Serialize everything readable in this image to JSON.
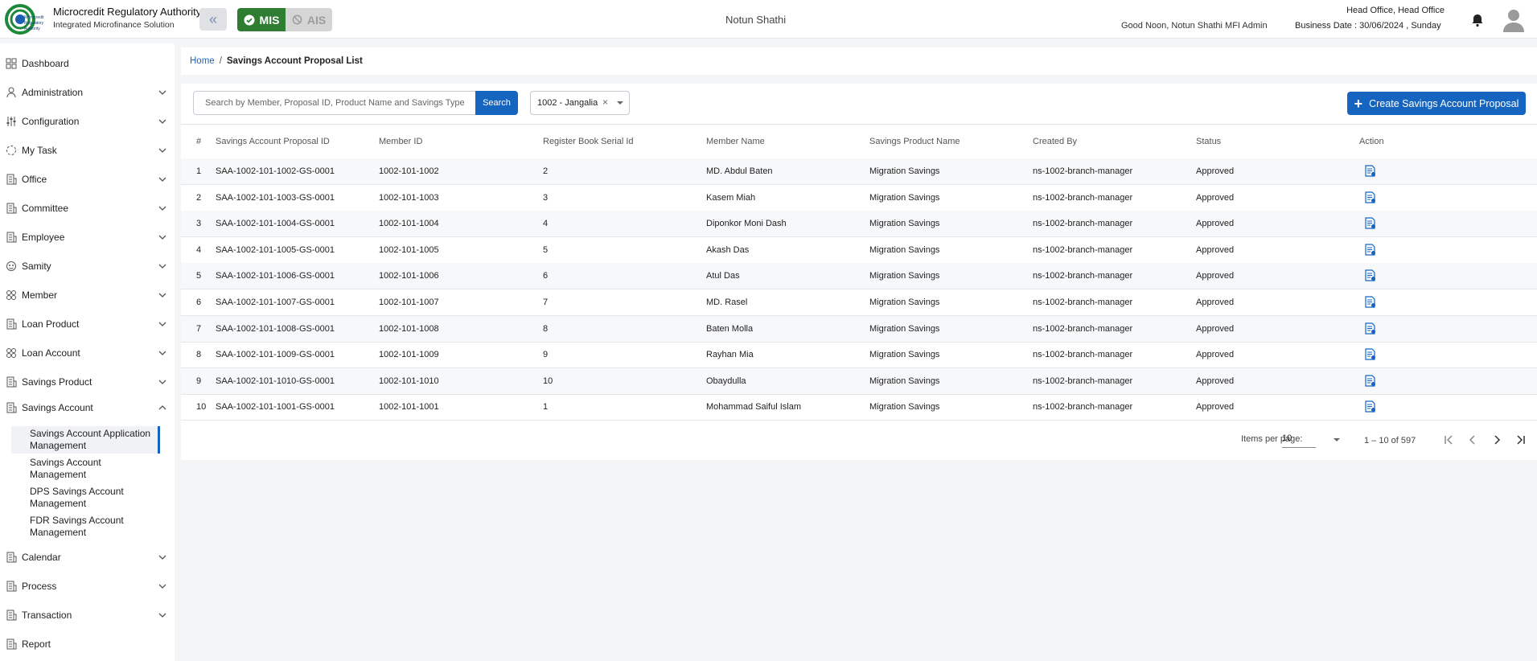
{
  "header": {
    "org_title": "Microcredit Regulatory Authority",
    "org_subtitle": "Integrated Microfinance Solution",
    "logo_text": "Microcredit Regulatory Authority",
    "mis_label": "MIS",
    "ais_label": "AIS",
    "center_title": "Notun Shathi",
    "greeting": "Good Noon, Notun Shathi MFI Admin",
    "office": "Head Office, Head Office",
    "business_date": "Business Date : 30/06/2024 , Sunday"
  },
  "sidebar": {
    "items": [
      {
        "label": "Dashboard",
        "icon": "dashboard-icon"
      },
      {
        "label": "Administration",
        "icon": "admin-icon"
      },
      {
        "label": "Configuration",
        "icon": "configuration-icon"
      },
      {
        "label": "My Task",
        "icon": "task-icon"
      },
      {
        "label": "Office",
        "icon": "office-icon"
      },
      {
        "label": "Committee",
        "icon": "committee-icon"
      },
      {
        "label": "Employee",
        "icon": "employee-icon"
      },
      {
        "label": "Samity",
        "icon": "samity-icon"
      },
      {
        "label": "Member",
        "icon": "member-icon"
      },
      {
        "label": "Loan Product",
        "icon": "loan-product-icon"
      },
      {
        "label": "Loan Account",
        "icon": "loan-account-icon"
      },
      {
        "label": "Savings Product",
        "icon": "savings-product-icon"
      },
      {
        "label": "Savings Account",
        "icon": "savings-account-icon"
      },
      {
        "label": "Calendar",
        "icon": "calendar-icon"
      },
      {
        "label": "Process",
        "icon": "process-icon"
      },
      {
        "label": "Transaction",
        "icon": "transaction-icon"
      },
      {
        "label": "Report",
        "icon": "report-icon"
      }
    ],
    "savings_sub": [
      "Savings Account Application Management",
      "Savings Account Management",
      "DPS Savings Account Management",
      "FDR Savings Account Management"
    ]
  },
  "breadcrumb": {
    "home": "Home",
    "separator": "/",
    "current": "Savings Account Proposal List"
  },
  "toolbar": {
    "search_placeholder": "Search by Member, Proposal ID, Product Name and Savings Type",
    "search_label": "Search",
    "branch_value": "1002 - Jangalia",
    "clear_symbol": "×",
    "create_label": "Create Savings Account Proposal"
  },
  "table": {
    "headers": [
      "#",
      "Savings Account Proposal ID",
      "Member ID",
      "Register Book Serial Id",
      "Member Name",
      "Savings Product Name",
      "Created By",
      "Status",
      "Action"
    ],
    "rows": [
      [
        "1",
        "SAA-1002-101-1002-GS-0001",
        "1002-101-1002",
        "2",
        "MD. Abdul Baten",
        "Migration Savings",
        "ns-1002-branch-manager",
        "Approved"
      ],
      [
        "2",
        "SAA-1002-101-1003-GS-0001",
        "1002-101-1003",
        "3",
        "Kasem Miah",
        "Migration Savings",
        "ns-1002-branch-manager",
        "Approved"
      ],
      [
        "3",
        "SAA-1002-101-1004-GS-0001",
        "1002-101-1004",
        "4",
        "Diponkor Moni Dash",
        "Migration Savings",
        "ns-1002-branch-manager",
        "Approved"
      ],
      [
        "4",
        "SAA-1002-101-1005-GS-0001",
        "1002-101-1005",
        "5",
        "Akash Das",
        "Migration Savings",
        "ns-1002-branch-manager",
        "Approved"
      ],
      [
        "5",
        "SAA-1002-101-1006-GS-0001",
        "1002-101-1006",
        "6",
        "Atul Das",
        "Migration Savings",
        "ns-1002-branch-manager",
        "Approved"
      ],
      [
        "6",
        "SAA-1002-101-1007-GS-0001",
        "1002-101-1007",
        "7",
        "MD. Rasel",
        "Migration Savings",
        "ns-1002-branch-manager",
        "Approved"
      ],
      [
        "7",
        "SAA-1002-101-1008-GS-0001",
        "1002-101-1008",
        "8",
        "Baten Molla",
        "Migration Savings",
        "ns-1002-branch-manager",
        "Approved"
      ],
      [
        "8",
        "SAA-1002-101-1009-GS-0001",
        "1002-101-1009",
        "9",
        "Rayhan Mia",
        "Migration Savings",
        "ns-1002-branch-manager",
        "Approved"
      ],
      [
        "9",
        "SAA-1002-101-1010-GS-0001",
        "1002-101-1010",
        "10",
        "Obaydulla",
        "Migration Savings",
        "ns-1002-branch-manager",
        "Approved"
      ],
      [
        "10",
        "SAA-1002-101-1001-GS-0001",
        "1002-101-1001",
        "1",
        "Mohammad Saiful Islam",
        "Migration Savings",
        "ns-1002-branch-manager",
        "Approved"
      ]
    ]
  },
  "paginator": {
    "items_per_page_label": "Items per page:",
    "page_size": "10",
    "range": "1 – 10 of 597"
  },
  "colors": {
    "primary": "#1565c0",
    "mis_green": "#2e7d32",
    "ais_grey": "#d5d5d5"
  }
}
